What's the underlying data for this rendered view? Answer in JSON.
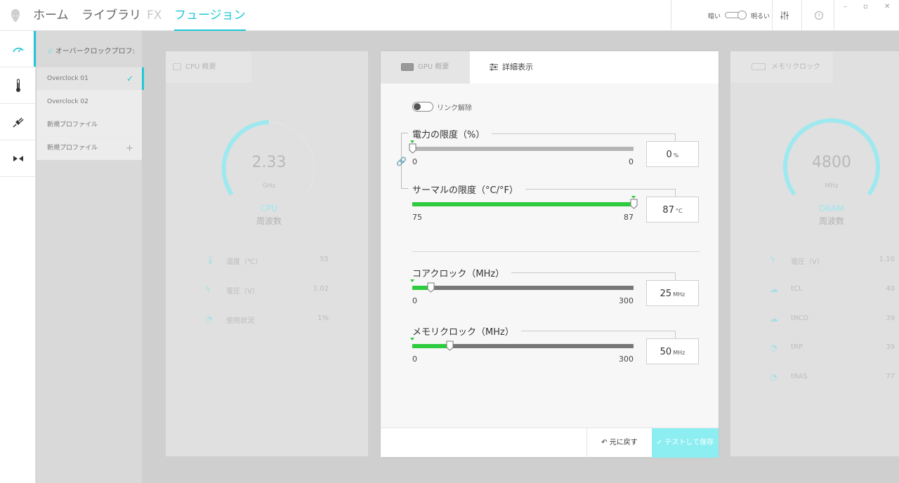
{
  "nav": {
    "tabs": [
      {
        "label": "ホーム"
      },
      {
        "label": "ライブラリ"
      },
      {
        "label": "FX"
      },
      {
        "label": "フュージョン"
      }
    ]
  },
  "topbar": {
    "theme_dark": "暗い",
    "theme_light": "明るい"
  },
  "rail": {
    "icons": [
      "overclock-gauge-icon",
      "thermometer-icon",
      "power-plug-icon",
      "hibernate-icon"
    ]
  },
  "profiles": {
    "title": "オーバークロックプロフ:",
    "items": [
      {
        "label": "Overclock 01"
      },
      {
        "label": "Overclock 02"
      },
      {
        "label": "新規プロファイル"
      },
      {
        "label": "新規プロファイル"
      }
    ]
  },
  "cpu_panel": {
    "tab_label": "CPU 概要",
    "gauge_value": "2.33",
    "gauge_unit": "GHz",
    "gauge_name": "CPU",
    "gauge_sub": "周波数",
    "stats": [
      {
        "label": "温度（℃）",
        "value": "55"
      },
      {
        "label": "電圧（V）",
        "value": "1.02"
      },
      {
        "label": "使用状況",
        "value": "1%"
      }
    ]
  },
  "memory_panel": {
    "tab_label": "メモリクロック",
    "gauge_value": "4800",
    "gauge_unit": "MHz",
    "gauge_name": "DRAM",
    "gauge_sub": "周波数",
    "stats": [
      {
        "label": "電圧（V）",
        "value": "1.10"
      },
      {
        "label": "tCL",
        "value": "40"
      },
      {
        "label": "tRCD",
        "value": "39"
      },
      {
        "label": "tRP",
        "value": "39"
      },
      {
        "label": "tRAS",
        "value": "77"
      }
    ]
  },
  "gpu_panel": {
    "tab_overview": "GPU 概要",
    "tab_detail": "詳細表示",
    "link_label": "リンク解除",
    "sliders": [
      {
        "title": "電力の限度（%）",
        "min": 0,
        "max": 0,
        "value": 0,
        "fraction": 0.0,
        "min_label": "0",
        "max_label": "0",
        "value_label": "0",
        "unit": "%"
      },
      {
        "title": "サーマルの限度（°C/°F）",
        "min": 75,
        "max": 87,
        "value": 87,
        "fraction": 1.0,
        "min_label": "75",
        "max_label": "87",
        "value_label": "87",
        "unit": "°C"
      },
      {
        "title": "コアクロック（MHz）",
        "min": 0,
        "max": 300,
        "value": 25,
        "fraction": 0.0833,
        "min_label": "0",
        "max_label": "300",
        "value_label": "25",
        "unit": "MHz"
      },
      {
        "title": "メモリクロック（MHz）",
        "min": 0,
        "max": 300,
        "value": 50,
        "fraction": 0.1667,
        "min_label": "0",
        "max_label": "300",
        "value_label": "50",
        "unit": "MHz"
      }
    ],
    "revert_label": "元に戻す",
    "save_label": "テストして保存"
  },
  "colors": {
    "accent": "#1fc8d6",
    "green": "#2ecb3e"
  }
}
